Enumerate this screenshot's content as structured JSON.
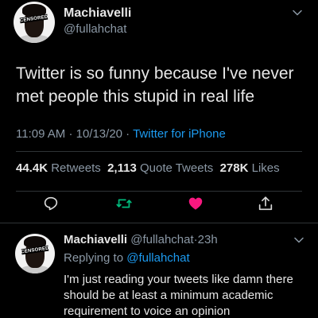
{
  "tweet": {
    "author": {
      "name": "Machiavelli",
      "handle": "@fullahchat",
      "avatar_badge": "CENSORED"
    },
    "text": "Twitter is so funny because I've never met people this stupid in real life",
    "time": "11:09 AM",
    "date": "10/13/20",
    "separator": "·",
    "source": "Twitter for iPhone",
    "stats": {
      "retweets_count": "44.4K",
      "retweets_label": "Retweets",
      "quotes_count": "2,113",
      "quotes_label": "Quote Tweets",
      "likes_count": "278K",
      "likes_label": "Likes"
    },
    "actions": {
      "reply_icon": "reply-icon",
      "retweet_icon": "retweet-icon",
      "like_icon": "heart-icon",
      "share_icon": "share-icon"
    }
  },
  "reply": {
    "author": {
      "name": "Machiavelli",
      "handle": "@fullahchat",
      "avatar_badge": "CENSORED"
    },
    "separator": "·",
    "age": "23h",
    "replying_prefix": "Replying to",
    "replying_to": "@fullahchat",
    "text": "I'm just reading your tweets like damn there should be at least a minimum academic requirement to voice an opinion"
  },
  "colors": {
    "background": "#000000",
    "link": "#1d9bf0",
    "retweet": "#00ba7c",
    "like": "#f91880",
    "muted": "#8b98a5"
  }
}
